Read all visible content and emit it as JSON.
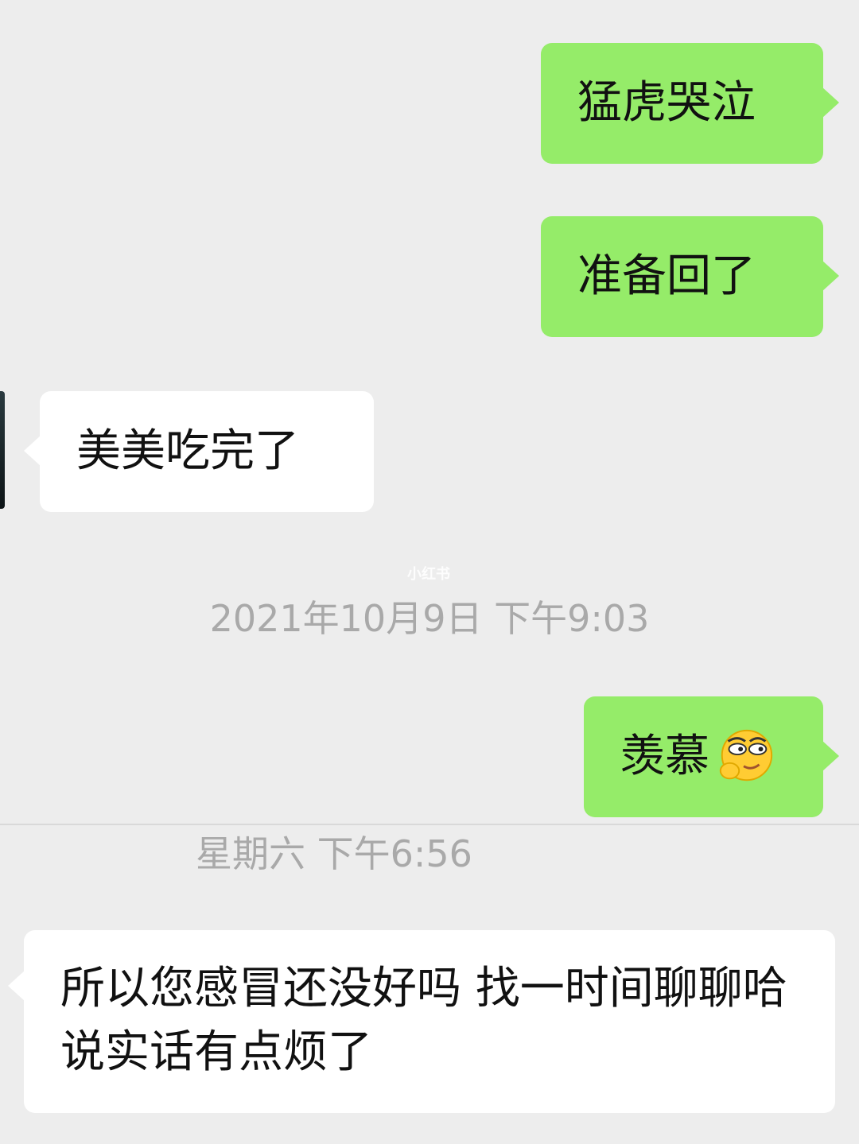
{
  "messages": [
    {
      "direction": "outgoing",
      "text": "猛虎哭泣"
    },
    {
      "direction": "outgoing",
      "text": "准备回了"
    },
    {
      "direction": "incoming",
      "text": "美美吃完了"
    },
    {
      "direction": "outgoing",
      "text": "羡慕",
      "emoji": "smirk-emoji-icon"
    },
    {
      "direction": "incoming",
      "text": "所以您感冒还没好吗 找一时间聊聊哈 说实话有点烦了"
    }
  ],
  "timestamps": [
    "2021年10月9日 下午9:03",
    "星期六 下午6:56"
  ],
  "watermark": "小红书",
  "colors": {
    "background": "#ededed",
    "outgoing_bubble": "#95ec69",
    "incoming_bubble": "#ffffff",
    "timestamp_text": "#a9a9a9"
  }
}
